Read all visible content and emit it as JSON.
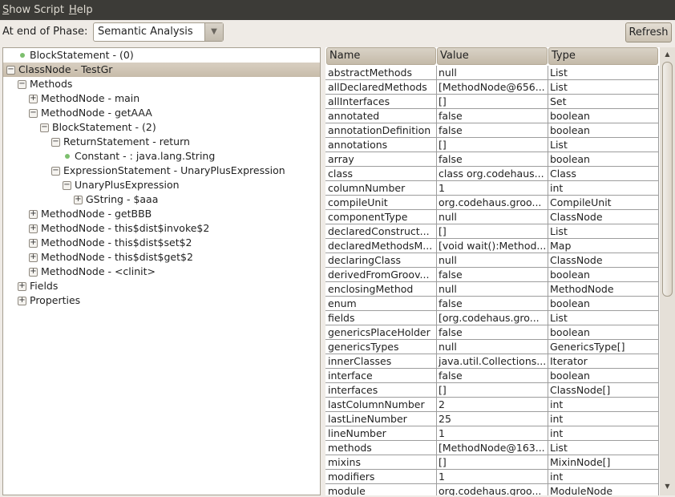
{
  "menu": [
    "Show Script",
    "Help"
  ],
  "phase": {
    "label": "At end of Phase:",
    "value": "Semantic Analysis"
  },
  "refresh_label": "Refresh",
  "tree": [
    {
      "level": 1,
      "kind": "leaf",
      "label": "BlockStatement - (0)"
    },
    {
      "level": 0,
      "kind": "expanded",
      "label": "ClassNode - TestGr",
      "selected": true
    },
    {
      "level": 1,
      "kind": "expanded",
      "label": "Methods"
    },
    {
      "level": 2,
      "kind": "collapsed",
      "label": "MethodNode - main"
    },
    {
      "level": 2,
      "kind": "expanded",
      "label": "MethodNode - getAAA"
    },
    {
      "level": 3,
      "kind": "expanded",
      "label": "BlockStatement - (2)"
    },
    {
      "level": 4,
      "kind": "expanded",
      "label": "ReturnStatement - return"
    },
    {
      "level": 5,
      "kind": "leaf",
      "label": "Constant -  : java.lang.String"
    },
    {
      "level": 4,
      "kind": "expanded",
      "label": "ExpressionStatement - UnaryPlusExpression"
    },
    {
      "level": 5,
      "kind": "expanded",
      "label": "UnaryPlusExpression"
    },
    {
      "level": 6,
      "kind": "collapsed",
      "label": "GString - $aaa"
    },
    {
      "level": 2,
      "kind": "collapsed",
      "label": "MethodNode - getBBB"
    },
    {
      "level": 2,
      "kind": "collapsed",
      "label": "MethodNode - this$dist$invoke$2"
    },
    {
      "level": 2,
      "kind": "collapsed",
      "label": "MethodNode - this$dist$set$2"
    },
    {
      "level": 2,
      "kind": "collapsed",
      "label": "MethodNode - this$dist$get$2"
    },
    {
      "level": 2,
      "kind": "collapsed",
      "label": "MethodNode - <clinit>"
    },
    {
      "level": 1,
      "kind": "collapsed",
      "label": "Fields"
    },
    {
      "level": 1,
      "kind": "collapsed",
      "label": "Properties"
    }
  ],
  "table": {
    "columns": [
      "Name",
      "Value",
      "Type"
    ],
    "rows": [
      [
        "abstractMethods",
        "null",
        "List"
      ],
      [
        "allDeclaredMethods",
        "[MethodNode@656...",
        "List"
      ],
      [
        "allInterfaces",
        "[]",
        "Set"
      ],
      [
        "annotated",
        "false",
        "boolean"
      ],
      [
        "annotationDefinition",
        "false",
        "boolean"
      ],
      [
        "annotations",
        "[]",
        "List"
      ],
      [
        "array",
        "false",
        "boolean"
      ],
      [
        "class",
        "class org.codehaus...",
        "Class"
      ],
      [
        "columnNumber",
        "1",
        "int"
      ],
      [
        "compileUnit",
        "org.codehaus.groo...",
        "CompileUnit"
      ],
      [
        "componentType",
        "null",
        "ClassNode"
      ],
      [
        "declaredConstruct...",
        "[]",
        "List"
      ],
      [
        "declaredMethodsM...",
        "[void wait():Method...",
        "Map"
      ],
      [
        "declaringClass",
        "null",
        "ClassNode"
      ],
      [
        "derivedFromGroov...",
        "false",
        "boolean"
      ],
      [
        "enclosingMethod",
        "null",
        "MethodNode"
      ],
      [
        "enum",
        "false",
        "boolean"
      ],
      [
        "fields",
        "[org.codehaus.gro...",
        "List"
      ],
      [
        "genericsPlaceHolder",
        "false",
        "boolean"
      ],
      [
        "genericsTypes",
        "null",
        "GenericsType[]"
      ],
      [
        "innerClasses",
        "java.util.Collections...",
        "Iterator"
      ],
      [
        "interface",
        "false",
        "boolean"
      ],
      [
        "interfaces",
        "[]",
        "ClassNode[]"
      ],
      [
        "lastColumnNumber",
        "2",
        "int"
      ],
      [
        "lastLineNumber",
        "25",
        "int"
      ],
      [
        "lineNumber",
        "1",
        "int"
      ],
      [
        "methods",
        "[MethodNode@163...",
        "List"
      ],
      [
        "mixins",
        "[]",
        "MixinNode[]"
      ],
      [
        "modifiers",
        "1",
        "int"
      ],
      [
        "module",
        "org.codehaus.groo...",
        "ModuleNode"
      ]
    ]
  }
}
